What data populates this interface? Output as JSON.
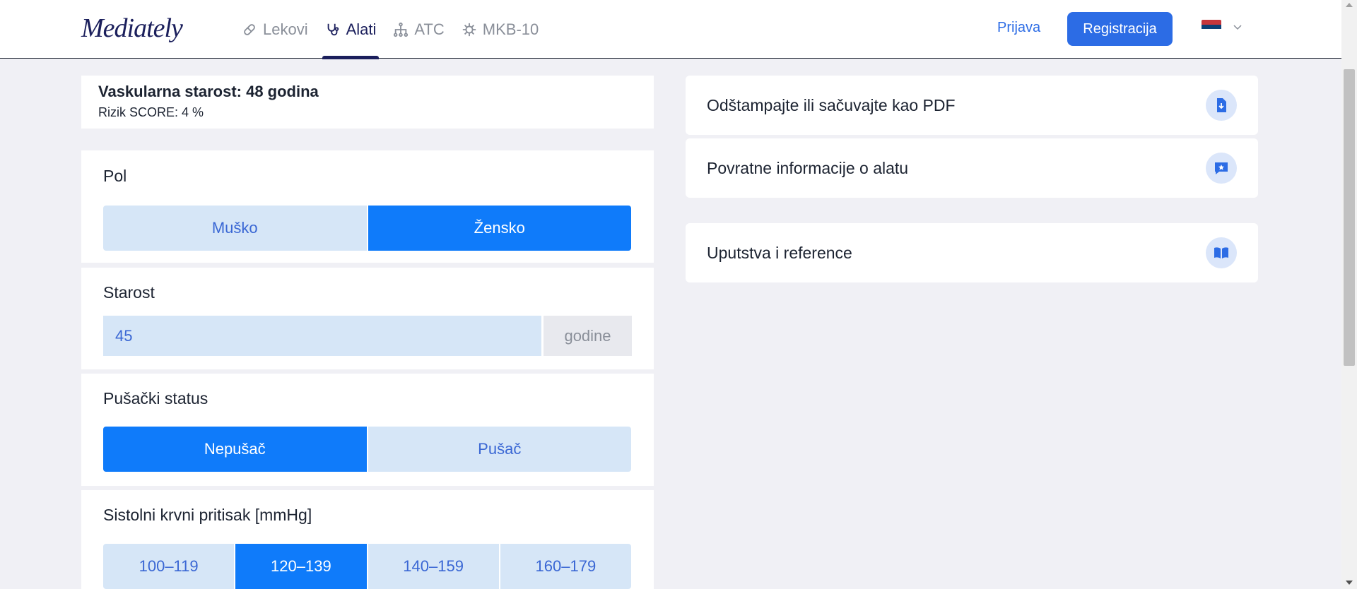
{
  "header": {
    "logo": "Mediately",
    "nav": [
      {
        "label": "Lekovi",
        "icon": "pill-icon",
        "active": false
      },
      {
        "label": "Alati",
        "icon": "stethoscope-icon",
        "active": true
      },
      {
        "label": "ATC",
        "icon": "hierarchy-icon",
        "active": false
      },
      {
        "label": "MKB-10",
        "icon": "virus-icon",
        "active": false
      }
    ],
    "login_label": "Prijava",
    "register_label": "Registracija",
    "language_flag": "serbia-flag-icon"
  },
  "result": {
    "title": "Vaskularna starost: 48 godina",
    "subtitle": "Rizik SCORE: 4 %"
  },
  "sex": {
    "label": "Pol",
    "options": [
      "Muško",
      "Žensko"
    ],
    "selected": "Žensko"
  },
  "age": {
    "label": "Starost",
    "value": "45",
    "unit": "godine"
  },
  "smoking": {
    "label": "Pušački status",
    "options": [
      "Nepušač",
      "Pušač"
    ],
    "selected": "Nepušač"
  },
  "blood_pressure": {
    "label": "Sistolni krvni pritisak [mmHg]",
    "options": [
      "100–119",
      "120–139",
      "140–159",
      "160–179"
    ],
    "selected": "120–139"
  },
  "side_actions": [
    {
      "label": "Odštampajte ili sačuvajte kao PDF",
      "icon": "pdf-download-icon"
    },
    {
      "label": "Povratne informacije o alatu",
      "icon": "feedback-icon"
    },
    {
      "label": "Uputstva i reference",
      "icon": "book-icon"
    }
  ],
  "colors": {
    "brand": "#1b1f5c",
    "primary": "#2c6ce5",
    "selected": "#0f7bfa",
    "option_bg": "#d6e6f7"
  }
}
